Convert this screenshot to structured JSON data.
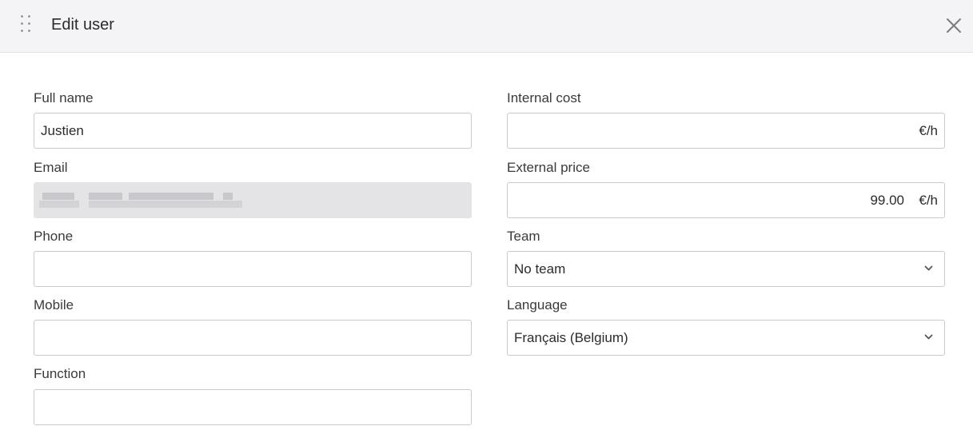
{
  "dialog": {
    "title": "Edit user",
    "drag_icon": "drag-handle-icon",
    "close_icon": "close-icon"
  },
  "form": {
    "full_name": {
      "label": "Full name",
      "value": "Justien"
    },
    "email": {
      "label": "Email",
      "value": ""
    },
    "phone": {
      "label": "Phone",
      "value": ""
    },
    "mobile": {
      "label": "Mobile",
      "value": ""
    },
    "function": {
      "label": "Function",
      "value": ""
    },
    "internal_cost": {
      "label": "Internal cost",
      "value": "",
      "unit": "€/h"
    },
    "external_price": {
      "label": "External price",
      "value": "99.00",
      "unit": "€/h"
    },
    "team": {
      "label": "Team",
      "selected": "No team"
    },
    "language": {
      "label": "Language",
      "selected": "Français (Belgium)"
    }
  },
  "colors": {
    "header_bg": "#f4f4f6",
    "border": "#c9c9ce",
    "readonly_bg": "#e4e4e6"
  }
}
